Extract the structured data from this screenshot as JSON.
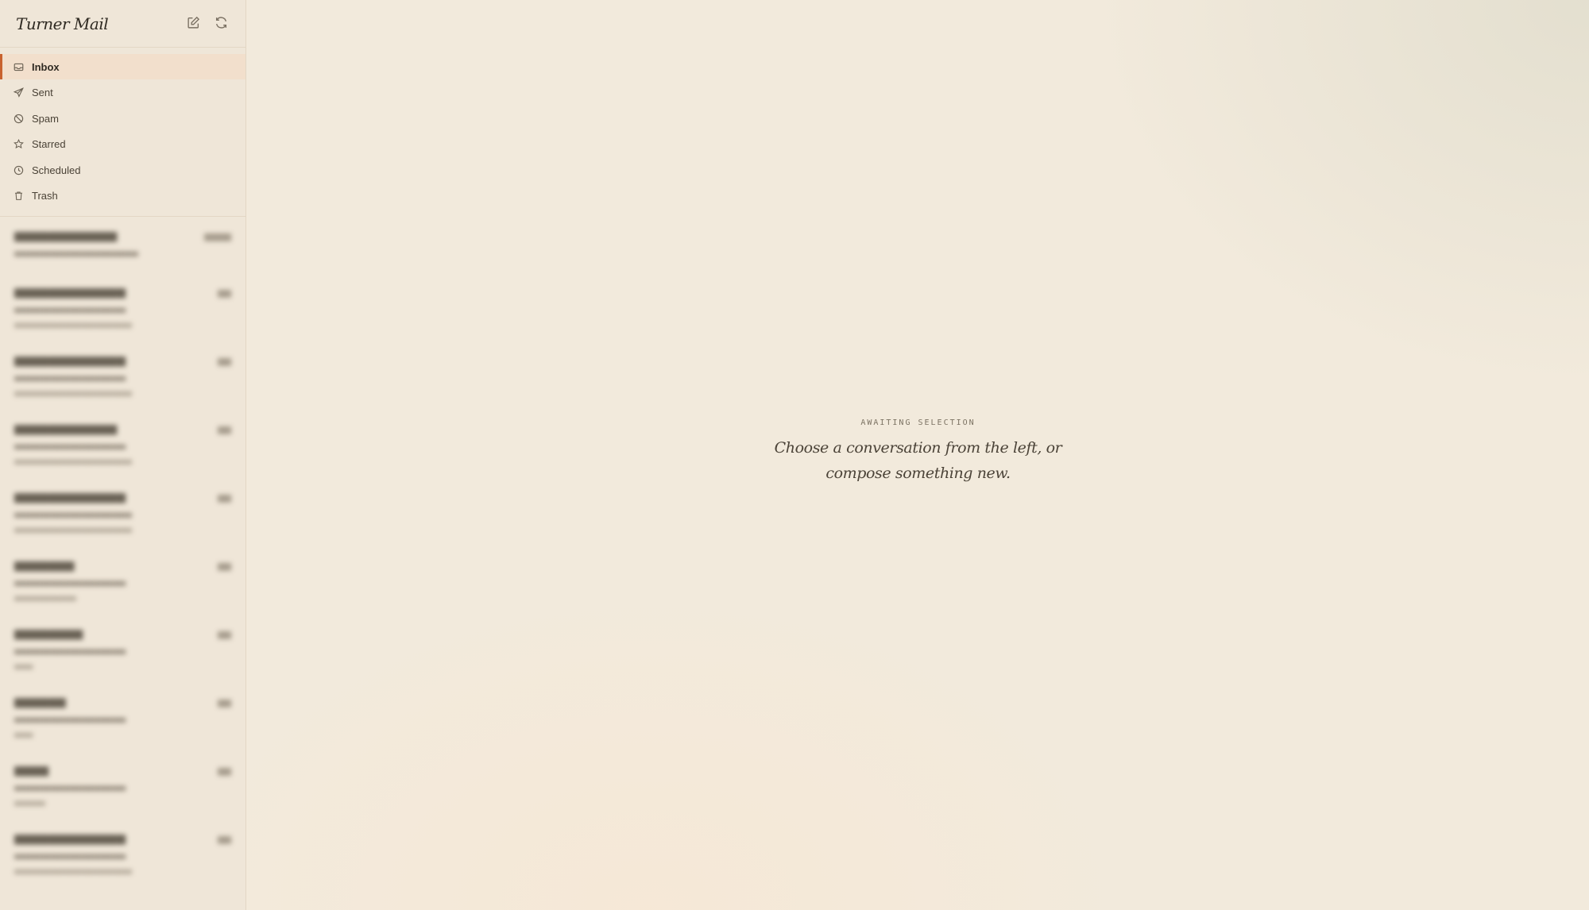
{
  "app": {
    "title": "Turner Mail"
  },
  "header": {
    "compose_icon": "compose-icon",
    "refresh_icon": "refresh-icon"
  },
  "sidebar": {
    "items": [
      {
        "label": "Inbox",
        "icon": "inbox-icon",
        "active": true
      },
      {
        "label": "Sent",
        "icon": "send-icon"
      },
      {
        "label": "Spam",
        "icon": "spam-icon"
      },
      {
        "label": "Starred",
        "icon": "star-icon"
      },
      {
        "label": "Scheduled",
        "icon": "clock-icon"
      },
      {
        "label": "Trash",
        "icon": "trash-icon"
      }
    ]
  },
  "colors": {
    "accent": "#c8622f",
    "active_bg": "#f2dfcc",
    "background": "#f2eadc"
  },
  "empty_state": {
    "eyebrow": "AWAITING SELECTION",
    "headline_line1": "Choose a conversation from the left, or",
    "headline_line2": "compose something new."
  }
}
